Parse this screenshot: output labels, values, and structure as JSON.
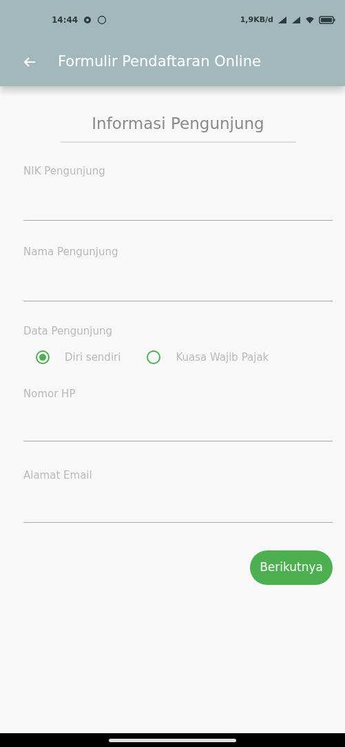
{
  "status_bar": {
    "time": "14:44",
    "speed": "1,9KB/d"
  },
  "app_bar": {
    "title": "Formulir Pendaftaran Online"
  },
  "section_title": "Informasi Pengunjung",
  "fields_top": [
    {
      "label": "NIK Pengunjung"
    },
    {
      "label": "Nama Pengunjung"
    }
  ],
  "visitor_type": {
    "label": "Data Pengunjung",
    "options": [
      {
        "label": "Diri sendiri",
        "selected": true
      },
      {
        "label": "Kuasa Wajib Pajak",
        "selected": false
      }
    ]
  },
  "fields_bottom": [
    {
      "label": "Nomor HP"
    },
    {
      "label": "Alamat Email"
    }
  ],
  "next_button": "Berikutnya"
}
